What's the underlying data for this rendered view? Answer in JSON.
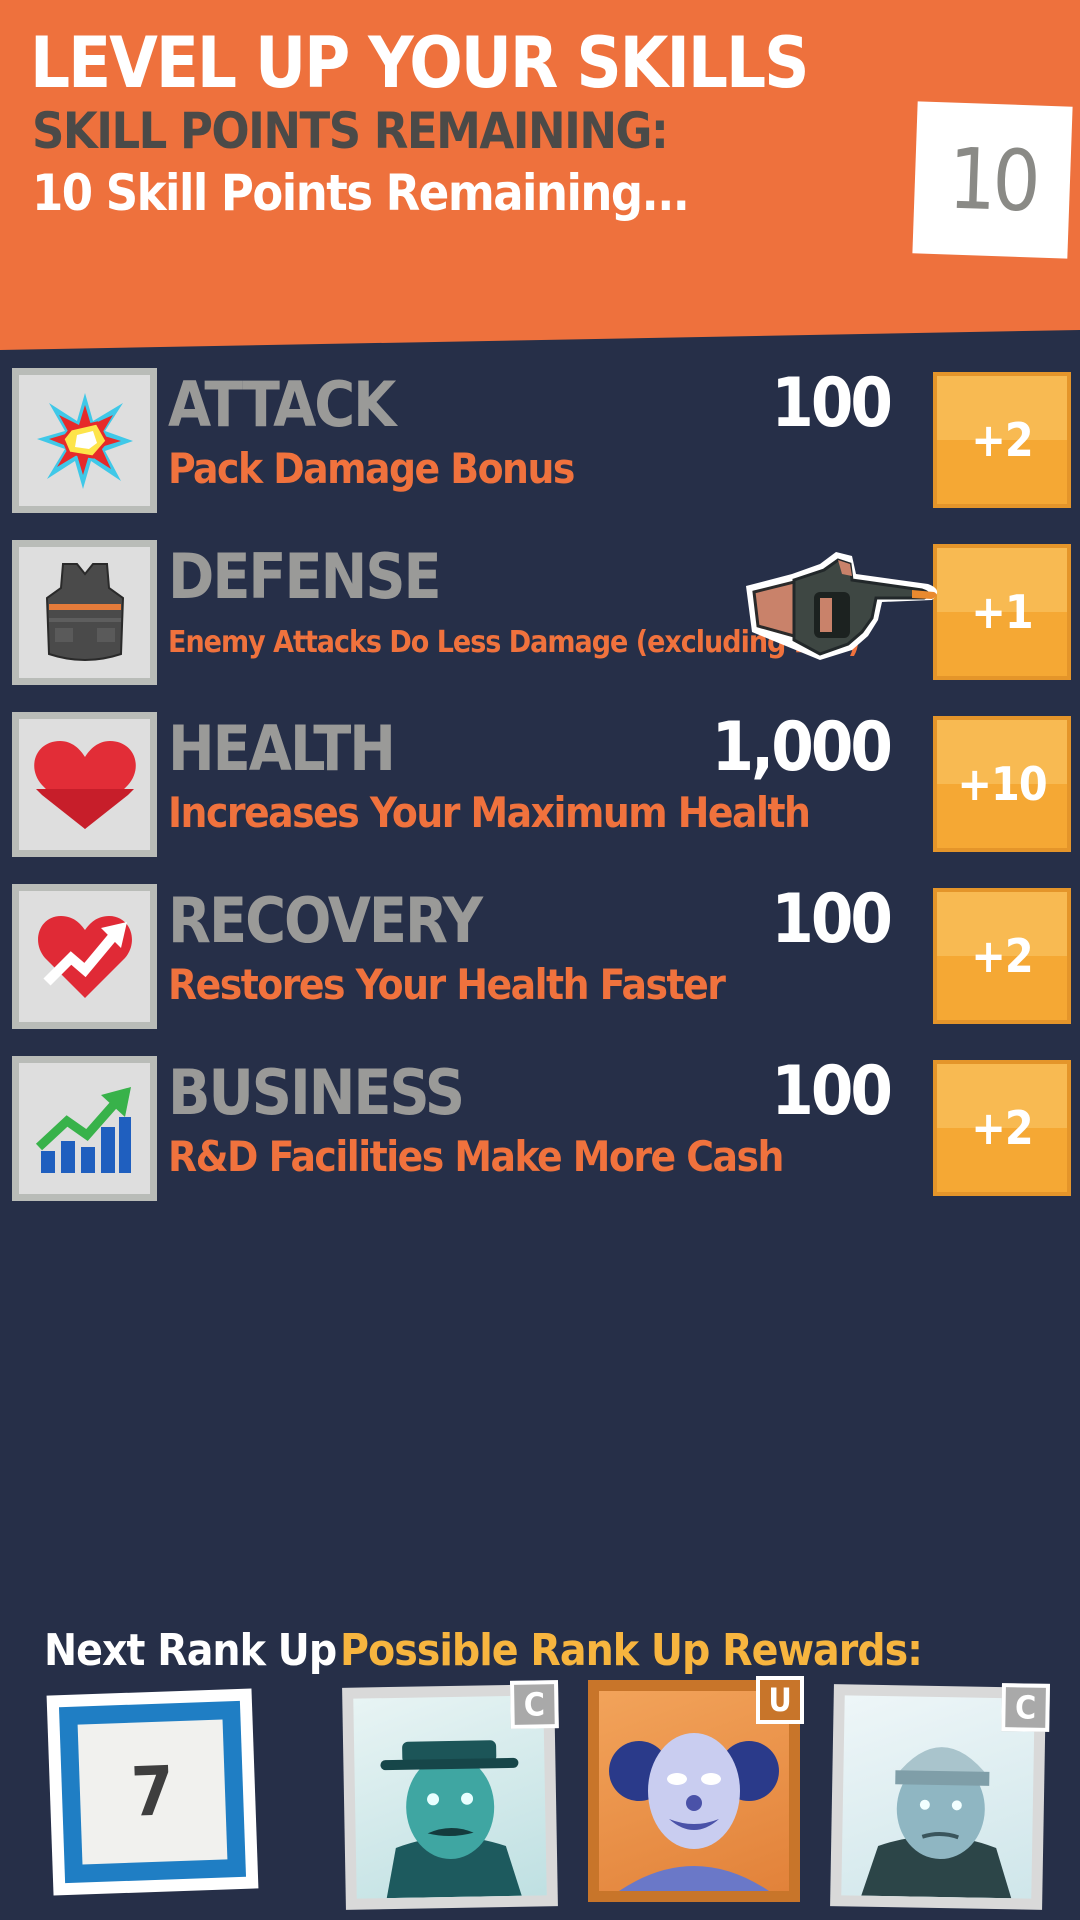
{
  "header": {
    "title": "LEVEL UP YOUR SKILLS",
    "subtitle": "SKILL POINTS REMAINING:",
    "remaining_text": "10 Skill Points Remaining...",
    "points": "10"
  },
  "skills": [
    {
      "name": "ATTACK",
      "desc": "Pack Damage Bonus",
      "value": "100",
      "button": "+2",
      "icon": "explosion-icon"
    },
    {
      "name": "DEFENSE",
      "desc": "Enemy Attacks Do Less Damage (excluding PvP)",
      "value": "",
      "button": "+1",
      "icon": "vest-icon"
    },
    {
      "name": "HEALTH",
      "desc": "Increases Your Maximum Health",
      "value": "1,000",
      "button": "+10",
      "icon": "heart-icon"
    },
    {
      "name": "RECOVERY",
      "desc": "Restores Your Health Faster",
      "value": "100",
      "button": "+2",
      "icon": "heart-arrow-icon"
    },
    {
      "name": "BUSINESS",
      "desc": "R&D Facilities Make More Cash",
      "value": "100",
      "button": "+2",
      "icon": "chart-up-icon"
    }
  ],
  "bottom": {
    "next_rank_label": "Next Rank Up",
    "next_rank_value": "7",
    "rewards_label": "Possible Rank Up Rewards:",
    "rewards": [
      {
        "rarity": "C",
        "color": "#a9a9a9"
      },
      {
        "rarity": "U",
        "color": "#c8752a"
      },
      {
        "rarity": "C",
        "color": "#a9a9a9"
      }
    ]
  },
  "colors": {
    "header_bg": "#ee713d",
    "body_bg": "#262f48",
    "accent_orange": "#f0723d",
    "button_yellow": "#f8ba52",
    "rewards_label": "#f7b53f"
  }
}
